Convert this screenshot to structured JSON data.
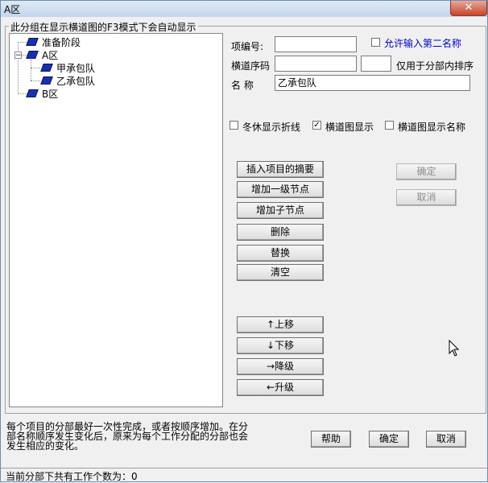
{
  "window": {
    "title": "A区",
    "close_label": "✕"
  },
  "group": {
    "label": "此分组在显示横道图的F3模式下会自动显示"
  },
  "tree": {
    "items": [
      {
        "label": "准备阶段"
      },
      {
        "label": "A区",
        "expander": "−"
      },
      {
        "label": "甲承包队"
      },
      {
        "label": "乙承包队"
      },
      {
        "label": "B区"
      }
    ]
  },
  "form": {
    "code_label": "项编号:",
    "code_value": "",
    "allow_second_name_label": "允许输入第二名称",
    "seq_label": "横道序码",
    "seq_value1": "",
    "seq_value2": "",
    "seq_note": "仅用于分部内排序",
    "name_label": "名  称",
    "name_value": "乙承包队",
    "cb_winter_label": "冬休显示折线",
    "cb_gantt_label": "横道图显示",
    "cb_gantt_checked": "✓",
    "cb_gantt_name_label": "横道图显示名称"
  },
  "buttons": {
    "insert_summary": "插入项目的摘要",
    "add_level1": "增加一级节点",
    "add_child": "增加子节点",
    "delete": "删除",
    "replace": "替换",
    "clear": "清空",
    "move_up": "↑上移",
    "move_down": "↓下移",
    "demote": "→降级",
    "promote": "←升级",
    "ok_top": "确定",
    "cancel_top": "取消",
    "help": "帮助",
    "ok": "确定",
    "cancel": "取消"
  },
  "hint": {
    "text": "每个项目的分部最好一次性完成，或者按顺序增加。在分部名称顺序发生变化后，原来为每个工作分配的分部也会发生相应的变化。"
  },
  "status": {
    "text": "当前分部下共有工作个数为：0"
  }
}
